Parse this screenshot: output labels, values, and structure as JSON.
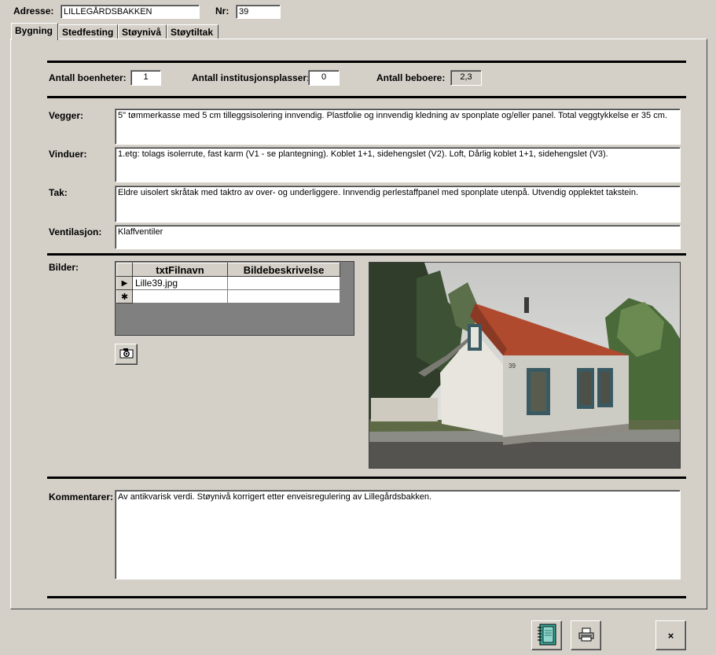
{
  "header": {
    "adresse_label": "Adresse:",
    "adresse_value": "LILLEGÅRDSBAKKEN",
    "nr_label": "Nr:",
    "nr_value": "39"
  },
  "tabs": [
    {
      "label": "Bygning",
      "active": true
    },
    {
      "label": "Stedfesting",
      "active": false
    },
    {
      "label": "Støynivå",
      "active": false
    },
    {
      "label": "Støytiltak",
      "active": false
    }
  ],
  "counts": {
    "boenheter_label": "Antall boenheter:",
    "boenheter_value": "1",
    "institusjon_label": "Antall institusjonsplasser:",
    "institusjon_value": "0",
    "beboere_label": "Antall beboere:",
    "beboere_value": "2,3"
  },
  "building": {
    "vegger_label": "Vegger:",
    "vegger_value": "5\" tømmerkasse med 5 cm tilleggsisolering innvendig. Plastfolie og innvendig kledning av sponplate og/eller panel. Total veggtykkelse er 35 cm.",
    "vinduer_label": "Vinduer:",
    "vinduer_value": "1.etg: tolags isolerrute, fast karm (V1 - se plantegning). Koblet 1+1, sidehengslet (V2). Loft, Dårlig koblet 1+1, sidehengslet (V3).",
    "tak_label": "Tak:",
    "tak_value": "Eldre uisolert skråtak med taktro av over- og underliggere. Innvendig perlestaffpanel med sponplate utenpå. Utvendig opplektet takstein.",
    "ventilasjon_label": "Ventilasjon:",
    "ventilasjon_value": "Klaffventiler"
  },
  "bilder": {
    "label": "Bilder:",
    "columns": [
      "txtFilnavn",
      "Bildebeskrivelse"
    ],
    "rows": [
      {
        "selector": "▶",
        "filnavn": "Lille39.jpg",
        "beskrivelse": ""
      },
      {
        "selector": "✱",
        "filnavn": "",
        "beskrivelse": ""
      }
    ],
    "house_number": "39"
  },
  "kommentarer": {
    "label": "Kommentarer:",
    "value": "Av antikvarisk verdi. Støynivå korrigert etter enveisregulering av Lillegårdsbakken."
  },
  "footer": {
    "close_label": "×"
  },
  "icons": {
    "camera": "camera-icon",
    "notebook": "notebook-icon",
    "printer": "printer-icon"
  }
}
